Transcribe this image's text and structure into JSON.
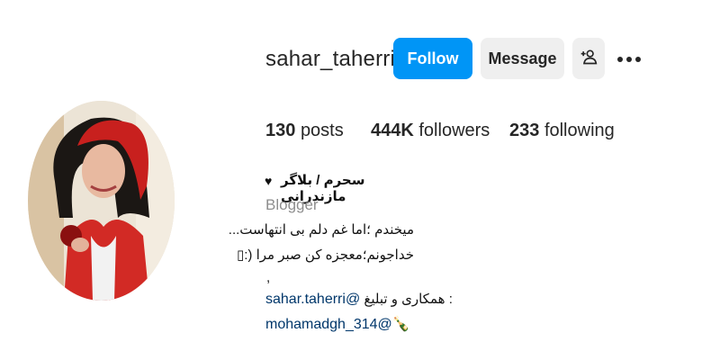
{
  "profile": {
    "username": "sahar_taherri",
    "follow_label": "Follow",
    "message_label": "Message",
    "add_user_icon": "add-user-icon",
    "more_icon": "more-horizontal-icon"
  },
  "stats": {
    "posts_count": "130",
    "posts_label": "posts",
    "followers_count": "444K",
    "followers_label": "followers",
    "following_count": "233",
    "following_label": "following"
  },
  "bio": {
    "name": "سحرم / بلاگر مازندرانی",
    "heart": "♥",
    "category": "Blogger",
    "line1": "میخندم ؛اما غم دلم بی انتهاست...",
    "line2": "خداجونم؛معجزه کن صبر مرا (:▯",
    "comma": ",",
    "contact_text": "همکاری و تبلیغ :",
    "contact_link": "sahar.taherri@",
    "link2": "mohamadgh_314@🍾"
  },
  "colors": {
    "follow_bg": "#0095f6",
    "secondary_bg": "#efefef",
    "link": "#00376b",
    "muted": "#8e8e8e"
  }
}
